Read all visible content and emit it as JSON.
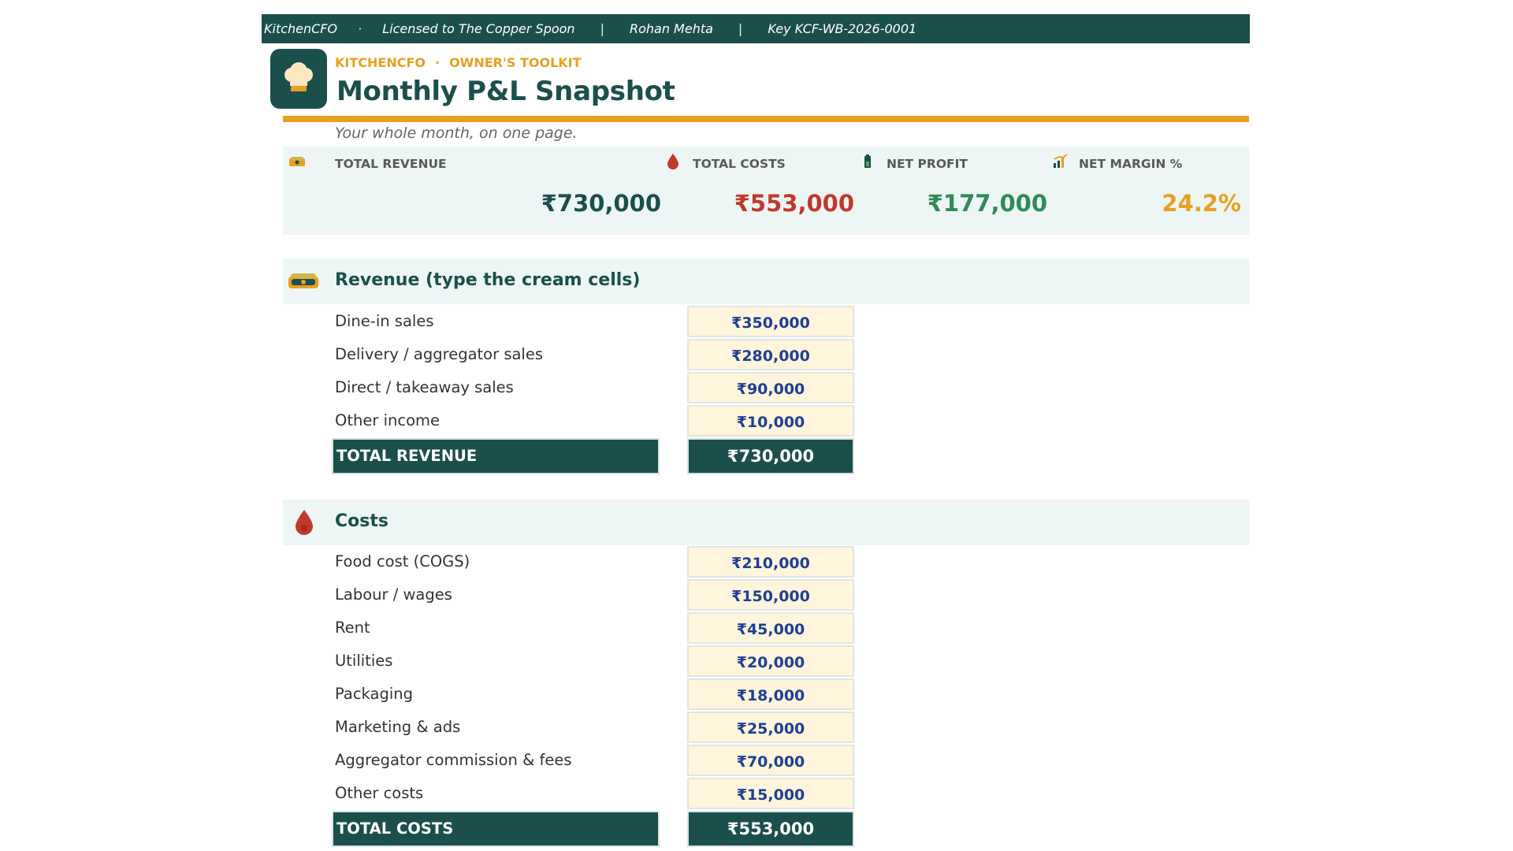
{
  "license_bar": {
    "app": "KitchenCFO",
    "sep_dot": "·",
    "licensed_to": "Licensed to The Copper Spoon",
    "sep_bar": "|",
    "user": "Rohan Mehta",
    "key": "Key KCF-WB-2026-0001"
  },
  "header": {
    "logo_icon": "chef-hat-icon",
    "brand": "KITCHENCFO",
    "brand_sep": "·",
    "toolkit": "OWNER'S TOOLKIT",
    "title": "Monthly P&L Snapshot",
    "tagline": "Your whole month, on one page."
  },
  "kpis": {
    "revenue": {
      "label": "TOTAL REVENUE",
      "value": "₹730,000",
      "icon": "money-stack-icon",
      "color": "#1b4f4c"
    },
    "costs": {
      "label": "TOTAL COSTS",
      "value": "₹553,000",
      "icon": "blood-drop-icon",
      "color": "#c0392b"
    },
    "profit": {
      "label": "NET PROFIT",
      "value": "₹177,000",
      "icon": "battery-icon",
      "color": "#2e8b57"
    },
    "margin": {
      "label": "NET MARGIN %",
      "value": "24.2%",
      "icon": "bar-chart-icon",
      "color": "#e8a020"
    }
  },
  "revenue": {
    "title": "Revenue (type the cream cells)",
    "icon": "money-stack-icon",
    "rows": [
      {
        "label": "Dine-in sales",
        "value": "₹350,000"
      },
      {
        "label": "Delivery / aggregator sales",
        "value": "₹280,000"
      },
      {
        "label": "Direct / takeaway sales",
        "value": "₹90,000"
      },
      {
        "label": "Other income",
        "value": "₹10,000"
      }
    ],
    "total_label": "TOTAL REVENUE",
    "total_value": "₹730,000"
  },
  "costs": {
    "title": "Costs",
    "icon": "blood-drop-icon",
    "rows": [
      {
        "label": "Food cost (COGS)",
        "value": "₹210,000"
      },
      {
        "label": "Labour / wages",
        "value": "₹150,000"
      },
      {
        "label": "Rent",
        "value": "₹45,000"
      },
      {
        "label": "Utilities",
        "value": "₹20,000"
      },
      {
        "label": "Packaging",
        "value": "₹18,000"
      },
      {
        "label": "Marketing & ads",
        "value": "₹25,000"
      },
      {
        "label": "Aggregator commission & fees",
        "value": "₹70,000"
      },
      {
        "label": "Other costs",
        "value": "₹15,000"
      }
    ],
    "total_label": "TOTAL COSTS",
    "total_value": "₹553,000"
  },
  "colors": {
    "primary": "#1b4f4c",
    "accent": "#e8a020",
    "input_cell": "#fff5dc",
    "input_text": "#1f3f94",
    "band": "#edf6f4"
  }
}
